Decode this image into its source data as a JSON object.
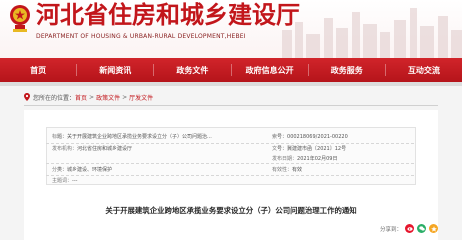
{
  "header": {
    "title": "河北省住房和城乡建设厅",
    "subtitle": "DEPARTMENT OF HOUSING & URBAN-RURAL DEVELOPMENT,HEBEI"
  },
  "nav": {
    "items": [
      {
        "label": "首页"
      },
      {
        "label": "新闻资讯"
      },
      {
        "label": "政务文件"
      },
      {
        "label": "政府信息公开"
      },
      {
        "label": "政务服务"
      },
      {
        "label": "互动交流"
      }
    ]
  },
  "breadcrumb": {
    "prefix": "您所在的位置：",
    "items": [
      "首页",
      "政策文件",
      "厅发文件"
    ],
    "separator": ">"
  },
  "meta": {
    "index_label": "索",
    "index_value": "号：000218069/2021-00220",
    "title_label": "标",
    "title_value": "题：关于开展建筑企业跨地区承揽业务要求设立分（子）公司问题治...",
    "publisher_label": "发布机构：",
    "publisher_value": "河北省住房和城乡建设厅",
    "docno_label": "文",
    "docno_value": "号：冀建建市函〔2021〕12号",
    "date_label": "发布日期：",
    "date_value": "2021年02月09日",
    "category_label": "分",
    "category_value": "类：城乡建设、环境保护",
    "validity_label": "有效性：",
    "validity_value": "有效",
    "subject_label": "主题词：",
    "subject_value": "---"
  },
  "document": {
    "title": "关于开展建筑企业跨地区承揽业务要求设立分（子）公司问题治理工作的通知"
  },
  "share": {
    "label": "分享到："
  },
  "colors": {
    "brand_red": "#c2161b",
    "nav_red": "#c81d23"
  }
}
